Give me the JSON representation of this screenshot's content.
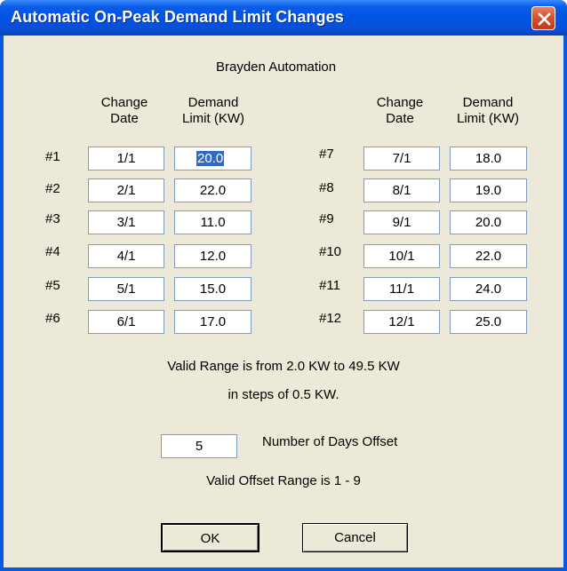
{
  "window": {
    "title": "Automatic On-Peak Demand Limit Changes"
  },
  "company": "Brayden Automation",
  "headers": {
    "change_date": [
      "Change",
      "Date"
    ],
    "demand_limit": [
      "Demand",
      "Limit (KW)"
    ]
  },
  "rows": [
    {
      "label": "#1",
      "date": "1/1",
      "limit": "20.0"
    },
    {
      "label": "#2",
      "date": "2/1",
      "limit": "22.0"
    },
    {
      "label": "#3",
      "date": "3/1",
      "limit": "11.0"
    },
    {
      "label": "#4",
      "date": "4/1",
      "limit": "12.0"
    },
    {
      "label": "#5",
      "date": "5/1",
      "limit": "15.0"
    },
    {
      "label": "#6",
      "date": "6/1",
      "limit": "17.0"
    },
    {
      "label": "#7",
      "date": "7/1",
      "limit": "18.0"
    },
    {
      "label": "#8",
      "date": "8/1",
      "limit": "19.0"
    },
    {
      "label": "#9",
      "date": "9/1",
      "limit": "20.0"
    },
    {
      "label": "#10",
      "date": "10/1",
      "limit": "22.0"
    },
    {
      "label": "#11",
      "date": "11/1",
      "limit": "24.0"
    },
    {
      "label": "#12",
      "date": "12/1",
      "limit": "25.0"
    }
  ],
  "range_info": [
    "Valid Range is from 2.0 KW to 49.5 KW",
    "in steps of 0.5 KW."
  ],
  "offset": {
    "value": "5",
    "label": "Number of Days Offset",
    "range": "Valid Offset Range is 1 - 9"
  },
  "buttons": {
    "ok": "OK",
    "cancel": "Cancel"
  }
}
